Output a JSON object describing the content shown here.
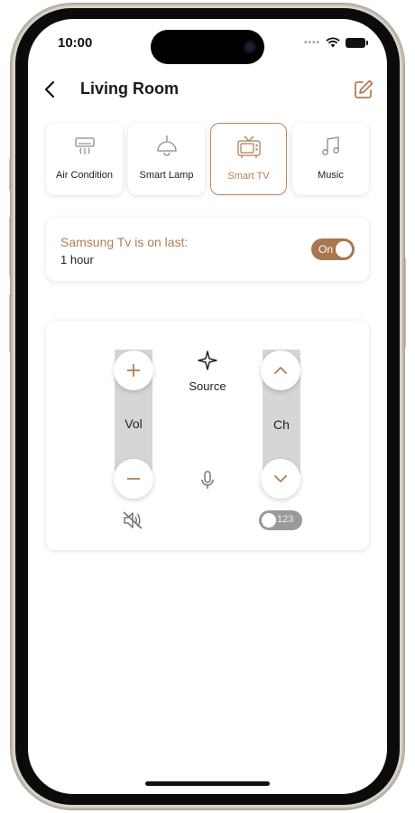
{
  "status_bar": {
    "time": "10:00"
  },
  "header": {
    "title": "Living Room",
    "back_icon": "chevron-left-icon",
    "edit_icon": "edit-icon"
  },
  "accent_color": "#b07e56",
  "devices": [
    {
      "label": "Air Condition",
      "icon": "air-conditioner-icon",
      "active": false
    },
    {
      "label": "Smart Lamp",
      "icon": "lamp-icon",
      "active": false
    },
    {
      "label": "Smart TV",
      "icon": "tv-icon",
      "active": true
    },
    {
      "label": "Music",
      "icon": "music-note-icon",
      "active": false
    }
  ],
  "status": {
    "message": "Samsung Tv is on last:",
    "duration": "1 hour",
    "toggle_label": "On",
    "toggle_on": true
  },
  "remote": {
    "volume_label": "Vol",
    "channel_label": "Ch",
    "source_label": "Source",
    "numpad_toggle_label": "123",
    "numpad_toggle_on": false
  }
}
